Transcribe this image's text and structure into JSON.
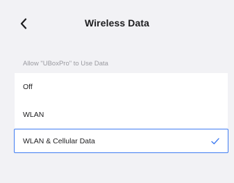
{
  "nav": {
    "title": "Wireless Data",
    "back_icon": "chevron-left-icon"
  },
  "section": {
    "header": "Allow \"UBoxPro\" to Use Data"
  },
  "options": [
    {
      "label": "Off",
      "selected": false
    },
    {
      "label": "WLAN",
      "selected": false
    },
    {
      "label": "WLAN & Cellular Data",
      "selected": true
    }
  ],
  "colors": {
    "background": "#f2f2f5",
    "card": "#ffffff",
    "accent": "#3f7cf2",
    "section_header": "#9a9aa0"
  },
  "icons": {
    "selected_check": "checkmark-icon"
  }
}
